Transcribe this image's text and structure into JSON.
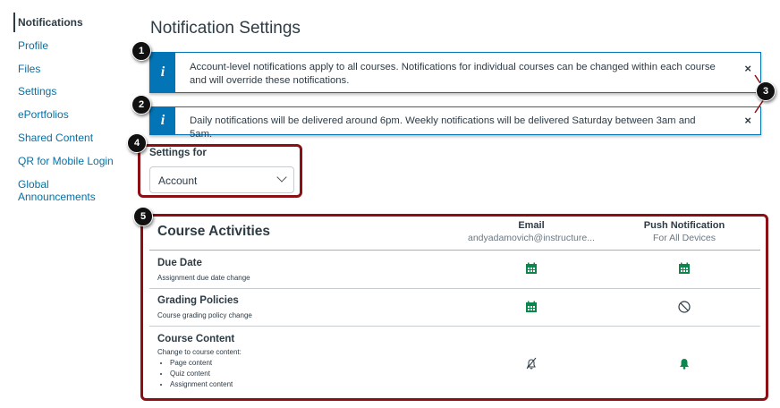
{
  "sidebar": {
    "items": [
      {
        "label": "Notifications",
        "active": true
      },
      {
        "label": "Profile"
      },
      {
        "label": "Files"
      },
      {
        "label": "Settings"
      },
      {
        "label": "ePortfolios"
      },
      {
        "label": "Shared Content"
      },
      {
        "label": "QR for Mobile Login"
      },
      {
        "label": "Global Announcements"
      }
    ]
  },
  "page": {
    "title": "Notification Settings"
  },
  "alerts": [
    {
      "icon": "info-icon",
      "text": "Account-level notifications apply to all courses. Notifications for individual courses can be changed within each course and will override these notifications.",
      "close": "×"
    },
    {
      "icon": "info-icon",
      "text": "Daily notifications will be delivered around 6pm. Weekly notifications will be delivered Saturday between 3am and 5am.",
      "close": "×"
    }
  ],
  "callouts": [
    "1",
    "2",
    "3",
    "4",
    "5"
  ],
  "settings_for": {
    "label": "Settings for",
    "value": "Account"
  },
  "table": {
    "title": "Course Activities",
    "columns": [
      {
        "label": "Email",
        "sub": "andyadamovich@instructure..."
      },
      {
        "label": "Push Notification",
        "sub": "For All Devices"
      }
    ],
    "rows": [
      {
        "title": "Due Date",
        "desc": "Assignment due date change",
        "email": "calendar-icon",
        "push": "calendar-icon"
      },
      {
        "title": "Grading Policies",
        "desc": "Course grading policy change",
        "email": "calendar-icon",
        "push": "disabled-icon"
      },
      {
        "title": "Course Content",
        "desc": "Change to course content:",
        "bullets": [
          "Page content",
          "Quiz content",
          "Assignment content"
        ],
        "email": "bell-off-icon",
        "push": "bell-icon"
      }
    ]
  },
  "colors": {
    "accent": "#0374b5",
    "success": "#0b874b",
    "callout_box": "#8b0f13"
  }
}
